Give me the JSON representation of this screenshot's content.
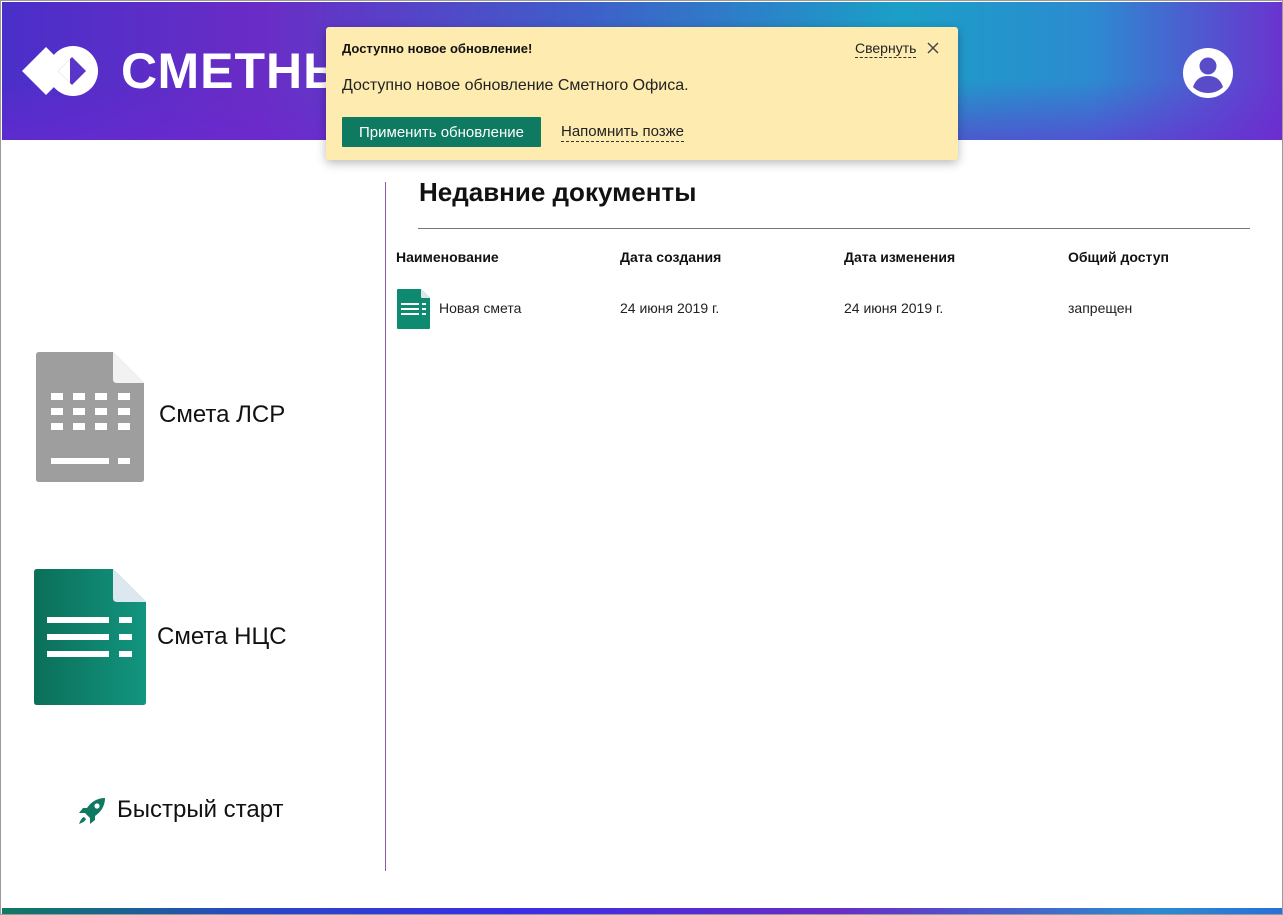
{
  "header": {
    "brand": "СМЕТНЫЙ"
  },
  "notification": {
    "title": "Доступно новое обновление!",
    "collapse_label": "Свернуть",
    "message": "Доступно новое обновление Сметного Офиса.",
    "apply_label": "Применить обновление",
    "remind_label": "Напомнить позже"
  },
  "sidebar": {
    "items": [
      {
        "label": "Смета ЛСР",
        "icon": "gray-spreadsheet-icon"
      },
      {
        "label": "Смета НЦС",
        "icon": "green-document-icon"
      },
      {
        "label": "Быстрый старт",
        "icon": "rocket-icon"
      }
    ]
  },
  "main": {
    "title": "Недавние документы",
    "columns": [
      "Наименование",
      "Дата создания",
      "Дата изменения",
      "Общий доступ"
    ],
    "rows": [
      {
        "name": "Новая смета",
        "created": "24 июня 2019 г.",
        "modified": "24 июня 2019 г.",
        "access": "запрещен"
      }
    ]
  },
  "colors": {
    "accent_green": "#0e7a62",
    "notice_bg": "#fdebb0",
    "divider_purple": "#8b5aa8"
  }
}
